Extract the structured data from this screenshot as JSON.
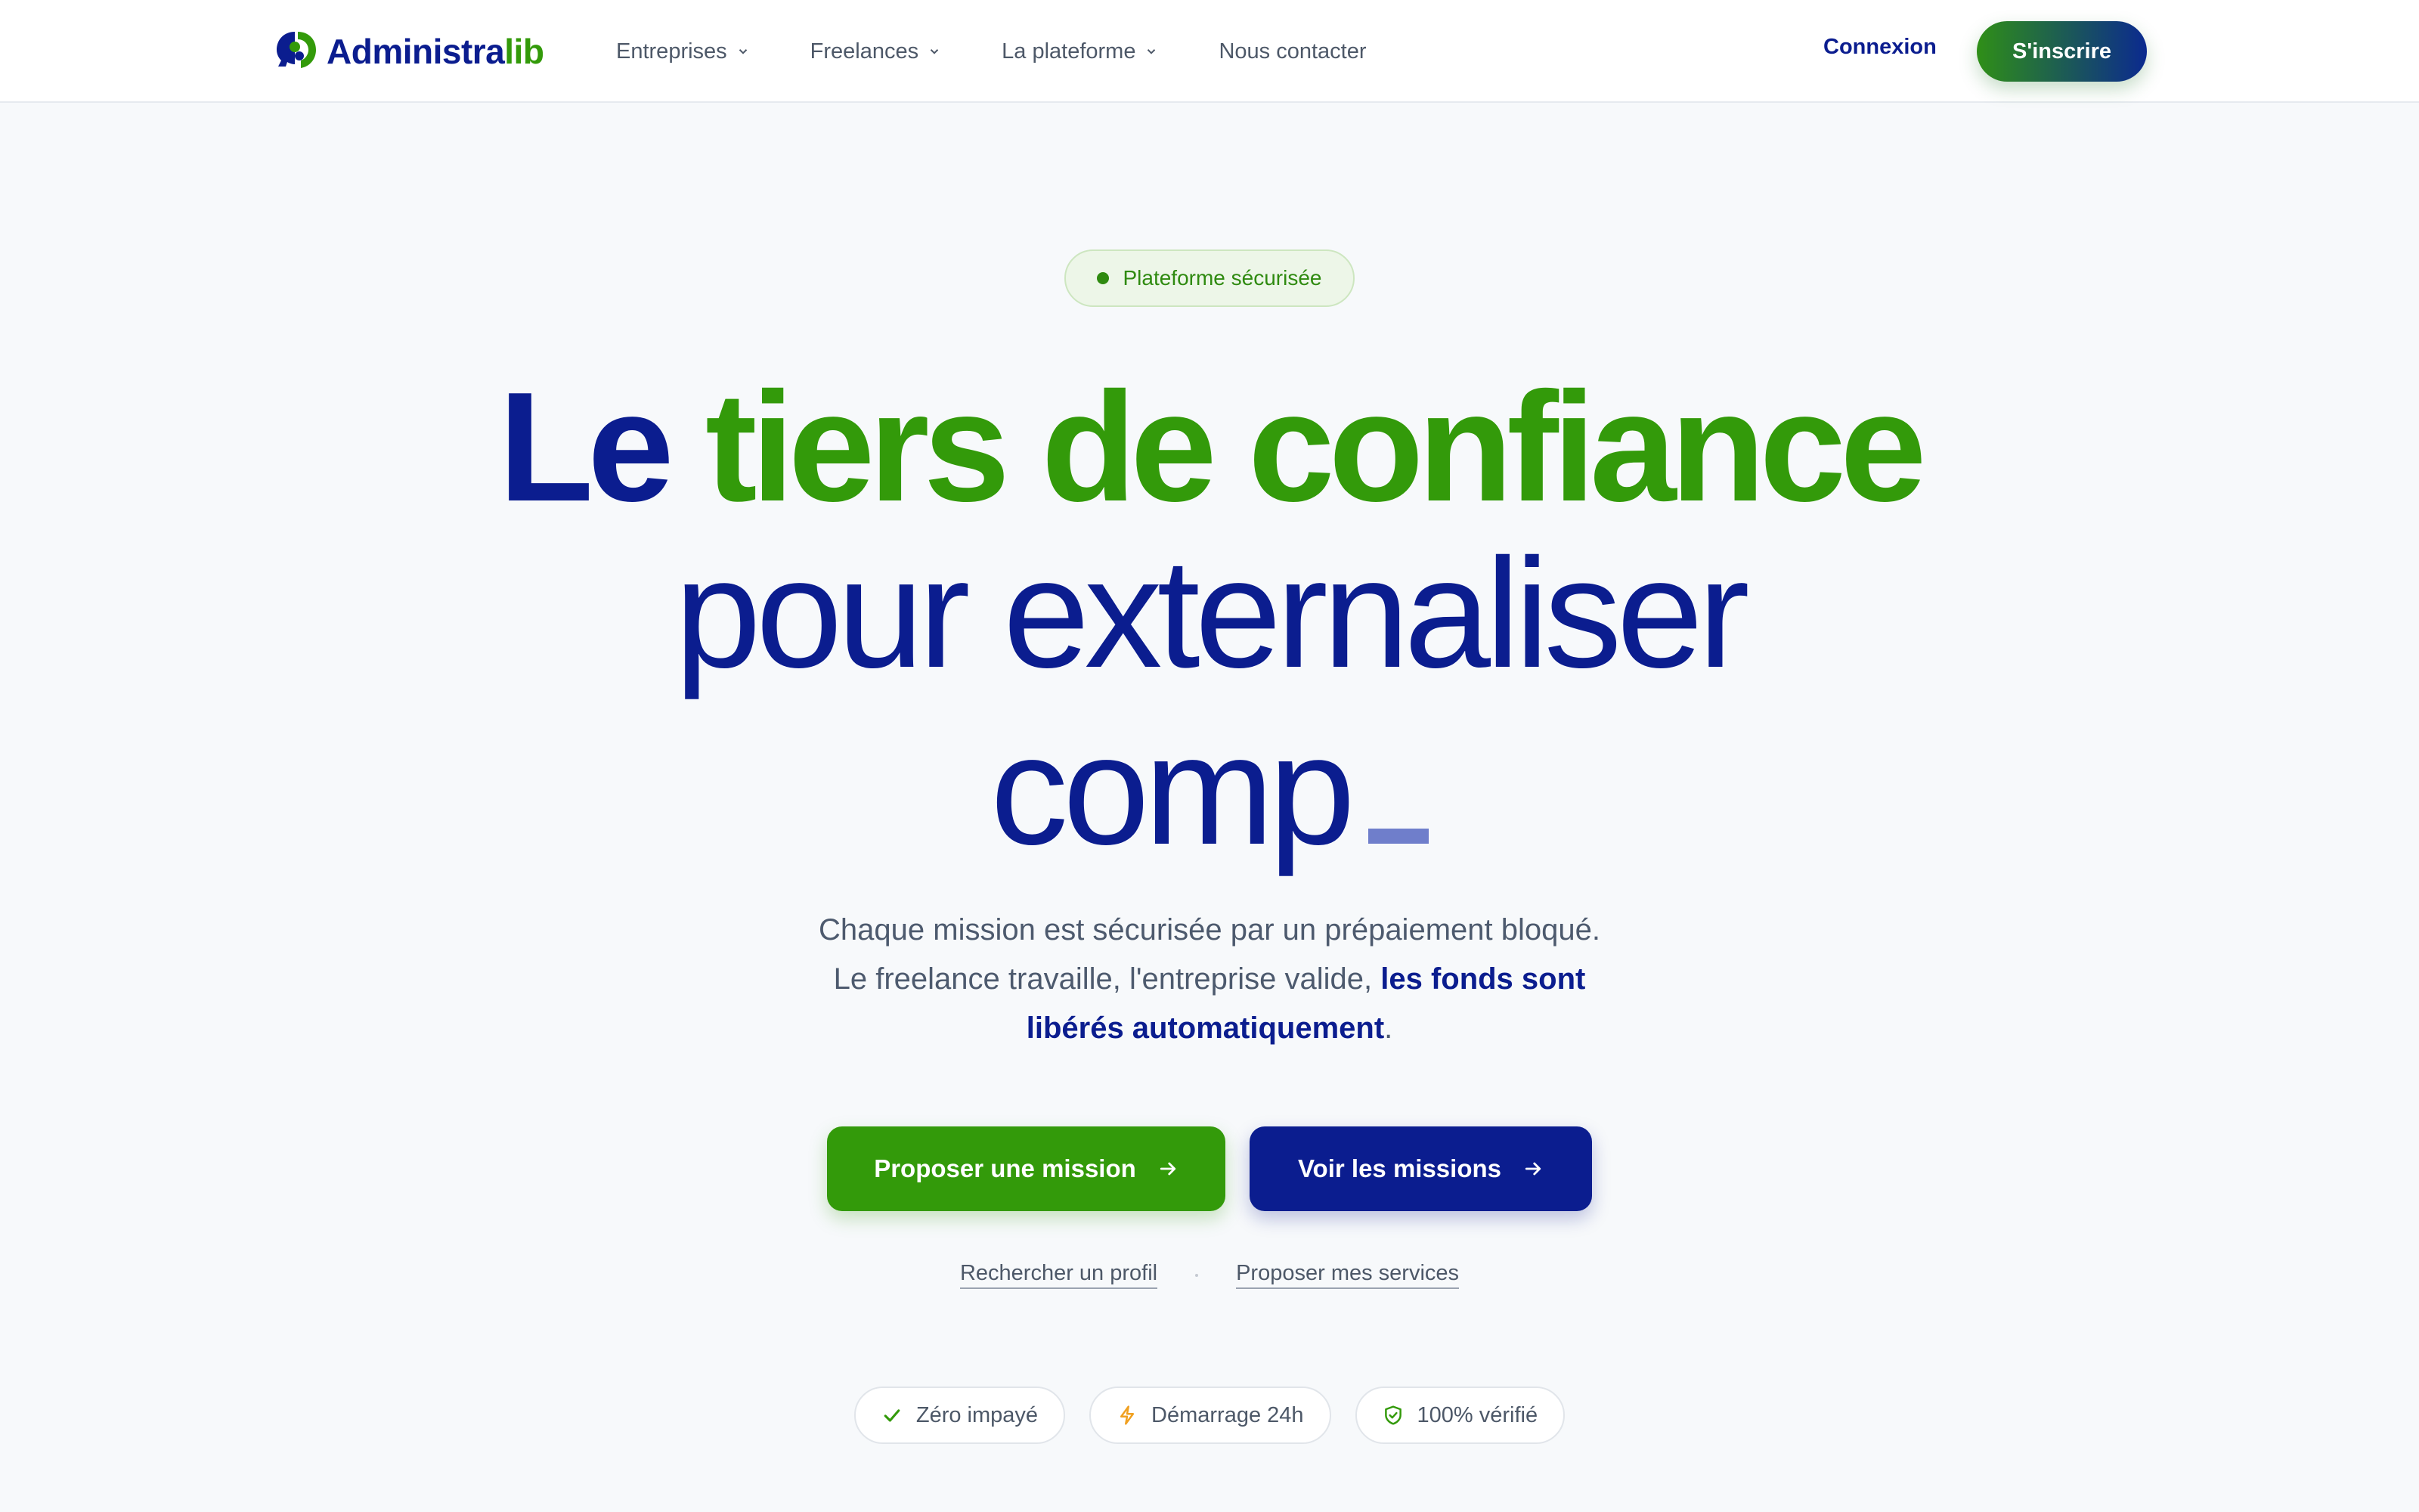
{
  "header": {
    "logo": {
      "part1": "Administra",
      "part2": "lib"
    },
    "nav": [
      {
        "label": "Entreprises",
        "has_dropdown": true
      },
      {
        "label": "Freelances",
        "has_dropdown": true
      },
      {
        "label": "La plateforme",
        "has_dropdown": true
      },
      {
        "label": "Nous contacter",
        "has_dropdown": false
      }
    ],
    "login_label": "Connexion",
    "signup_label": "S'inscrire"
  },
  "hero": {
    "badge": "Plateforme sécurisée",
    "headline": {
      "line1_blue": "Le",
      "line1_green": "tiers de confiance",
      "line2": "pour externaliser",
      "line3": "comp"
    },
    "subtitle": {
      "line1": "Chaque mission est sécurisée par un prépaiement bloqué.",
      "line2_plain": "Le freelance travaille, l'entreprise valide,",
      "line2_bold": "les fonds sont",
      "line3_bold": "libérés automatiquement",
      "line3_end": "."
    },
    "cta_primary": "Proposer une mission",
    "cta_secondary": "Voir les missions",
    "link_search": "Rechercher un profil",
    "link_offer": "Proposer mes services"
  },
  "features": [
    {
      "icon": "check-icon",
      "label": "Zéro impayé",
      "color": "#339a0a"
    },
    {
      "icon": "lightning-icon",
      "label": "Démarrage 24h",
      "color": "#f0a020"
    },
    {
      "icon": "shield-check-icon",
      "label": "100% vérifié",
      "color": "#339a0a"
    }
  ],
  "colors": {
    "brand_blue": "#0b1d8f",
    "brand_green": "#339a0a",
    "background": "#f7f9fb"
  }
}
